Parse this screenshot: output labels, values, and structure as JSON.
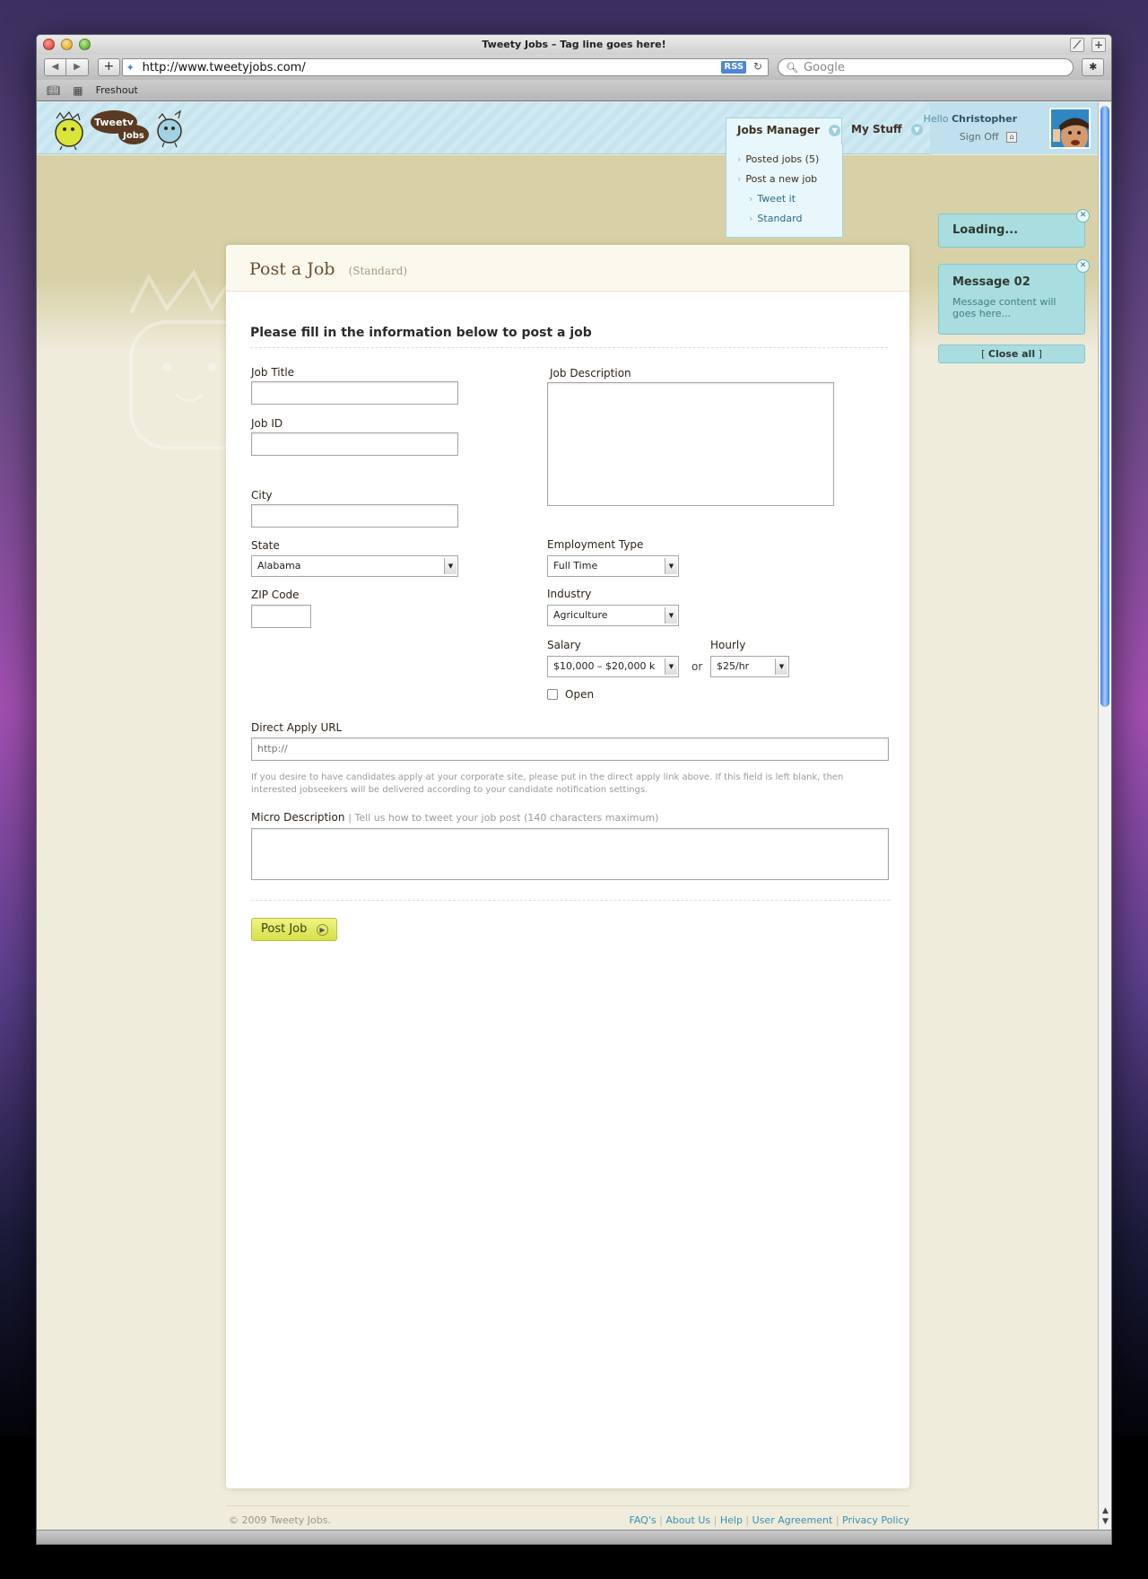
{
  "browser": {
    "window_title": "Tweety Jobs – Tag line goes here!",
    "url": "http://www.tweetyjobs.com/",
    "rss_label": "RSS",
    "search_placeholder": "Google",
    "bookmarks": [
      "Freshout"
    ]
  },
  "header": {
    "logo_text_1": "Tweety",
    "logo_text_2": "Jobs",
    "nav": [
      {
        "label": "Jobs Manager"
      },
      {
        "label": "My Stuff"
      }
    ],
    "hello_prefix": "Hello",
    "user_name": "Christopher",
    "sign_off": "Sign Off"
  },
  "dropdown": {
    "items": [
      "Posted jobs (5)",
      "Post a new job"
    ],
    "sub_items": [
      "Tweet it",
      "Standard"
    ]
  },
  "page": {
    "title": "Post a Job",
    "subtitle": "(Standard)",
    "section_title": "Please fill in the information below to post a job"
  },
  "form": {
    "job_title_label": "Job Title",
    "job_id_label": "Job ID",
    "city_label": "City",
    "state_label": "State",
    "state_value": "Alabama",
    "zip_label": "ZIP Code",
    "description_label": "Job Description",
    "employment_type_label": "Employment Type",
    "employment_type_value": "Full Time",
    "industry_label": "Industry",
    "industry_value": "Agriculture",
    "salary_label": "Salary",
    "salary_value": "$10,000 – $20,000 k",
    "or_label": "or",
    "hourly_label": "Hourly",
    "hourly_value": "$25/hr",
    "open_label": "Open",
    "direct_apply_label": "Direct Apply URL",
    "direct_apply_value": "http://",
    "direct_apply_hint": "If you desire to have candidates apply at your corporate site, please put in the direct apply link above. If this field is left blank, then interested jobseekers will be delivered according to your candidate notification settings.",
    "micro_label": "Micro Description",
    "micro_hint": "| Tell us how to tweet your job post (140 characters maximum)",
    "submit_label": "Post Job"
  },
  "notifications": {
    "loading_title": "Loading...",
    "message_title": "Message 02",
    "message_body": "Message content will goes here...",
    "close_all_open": "[",
    "close_all_label": "Close all",
    "close_all_close": "]"
  },
  "footer": {
    "copyright": "© 2009 Tweety Jobs.",
    "links": [
      "FAQ's",
      "About Us",
      "Help",
      "User Agreement",
      "Privacy Policy"
    ],
    "separator": "|"
  }
}
